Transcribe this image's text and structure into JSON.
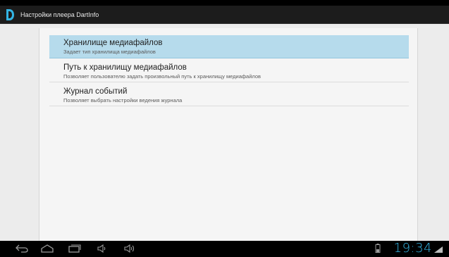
{
  "app": {
    "title": "Настройки плеера DartInfo",
    "icon": "dartinfo-logo-icon"
  },
  "preferences": [
    {
      "title": "Хранилище медиафайлов",
      "summary": "Задает тип хранилища медиафайлов",
      "selected": true
    },
    {
      "title": "Путь к хранилищу медиафайлов",
      "summary": "Позволяет пользователю задать произвольный путь к хранилищу медиафайлов",
      "selected": false
    },
    {
      "title": "Журнал событий",
      "summary": "Позволяет выбрать настройки ведения журнала",
      "selected": false
    }
  ],
  "navbar": {
    "buttons": [
      "back-icon",
      "home-icon",
      "recent-apps-icon",
      "volume-down-icon",
      "volume-up-icon"
    ],
    "clock": "19:34"
  },
  "colors": {
    "accent": "#33b5e5",
    "selected_bg": "#b6dbec",
    "actionbar_bg": "#1c1c1c",
    "content_bg": "#ececec"
  }
}
